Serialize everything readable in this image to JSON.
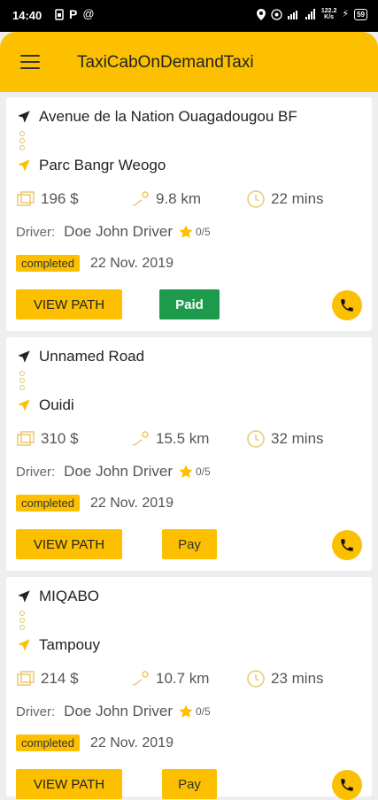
{
  "status_bar": {
    "time": "14:40",
    "net_speed_value": "122.2",
    "net_speed_unit": "K/s",
    "battery": "59"
  },
  "app_bar": {
    "title": "TaxiCabOnDemandTaxi"
  },
  "rides": [
    {
      "from": "Avenue de la Nation Ouagadougou BF",
      "to": "Parc Bangr Weogo",
      "price": "196 $",
      "distance": "9.8 km",
      "duration": "22 mins",
      "driver_label": "Driver:",
      "driver_name": "Doe John Driver",
      "rating": "0/5",
      "status": "completed",
      "date": "22 Nov. 2019",
      "view_path_label": "VIEW PATH",
      "payment_label": "Paid"
    },
    {
      "from": "Unnamed Road",
      "to": "Ouidi",
      "price": "310 $",
      "distance": "15.5 km",
      "duration": "32 mins",
      "driver_label": "Driver:",
      "driver_name": "Doe John Driver",
      "rating": "0/5",
      "status": "completed",
      "date": "22 Nov. 2019",
      "view_path_label": "VIEW PATH",
      "payment_label": "Pay"
    },
    {
      "from": "MIQABO",
      "to": "Tampouy",
      "price": "214 $",
      "distance": "10.7 km",
      "duration": "23 mins",
      "driver_label": "Driver:",
      "driver_name": "Doe John Driver",
      "rating": "0/5",
      "status": "completed",
      "date": "22 Nov. 2019",
      "view_path_label": "VIEW PATH",
      "payment_label": "Pay"
    }
  ],
  "colors": {
    "accent": "#fcc000",
    "paid": "#1e9a4c",
    "background": "#eeeeee"
  },
  "icons": [
    "menu-icon",
    "navigation-arrow-icon",
    "money-icon",
    "distance-icon",
    "timer-icon",
    "star-icon",
    "phone-icon"
  ]
}
